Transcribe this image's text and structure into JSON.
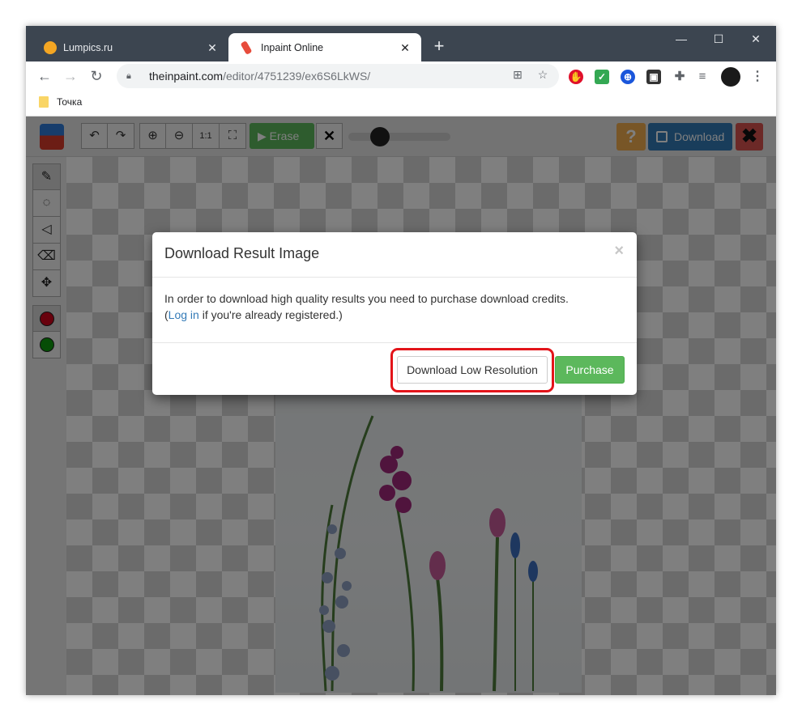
{
  "browser": {
    "tabs": [
      {
        "title": "Lumpics.ru",
        "favicon_color": "#f4a623",
        "active": false
      },
      {
        "title": "Inpaint Online",
        "favicon_color": "#e74c3c",
        "active": true
      }
    ],
    "new_tab_label": "+",
    "window_controls": {
      "minimize": "—",
      "maximize": "☐",
      "close": "✕"
    },
    "address": {
      "host": "theinpaint.com",
      "path": "/editor/4751239/ex6S6LkWS/"
    },
    "bookmarks": [
      {
        "label": "Точка"
      }
    ],
    "extensions": [
      {
        "name": "adblock",
        "color": "#e0102b"
      },
      {
        "name": "check",
        "color": "#34a853"
      },
      {
        "name": "vpn",
        "color": "#1a56db"
      },
      {
        "name": "package",
        "color": "#333333"
      },
      {
        "name": "puzzle",
        "color": "#5f6368"
      },
      {
        "name": "playlist",
        "color": "#5f6368"
      }
    ]
  },
  "editor": {
    "toolbar": {
      "erase_label": "Erase",
      "download_label": "Download",
      "help_label": "?",
      "close_label": "✖"
    },
    "side_tools": [
      "marker",
      "lasso",
      "polygon",
      "eraser",
      "move"
    ],
    "colors": {
      "red": "#d0021b",
      "green": "#0d9b0d"
    }
  },
  "modal": {
    "title": "Download Result Image",
    "close_label": "×",
    "message": "In order to download high quality results you need to purchase download credits.",
    "login_prefix": "(",
    "login_link": "Log in",
    "login_suffix": " if you're already registered.)",
    "low_res_button": "Download Low Resolution",
    "purchase_button": "Purchase"
  }
}
